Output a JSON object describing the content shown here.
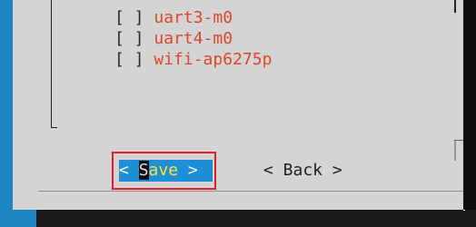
{
  "list": {
    "items": [
      {
        "checkbox": "[ ]",
        "name": "uart3-m0"
      },
      {
        "checkbox": "[ ]",
        "name": "uart4-m0"
      },
      {
        "checkbox": "[ ]",
        "name": "wifi-ap6275p"
      }
    ]
  },
  "buttons": {
    "save": {
      "left": "<",
      "hotkey": "S",
      "rest": "ave",
      "right": ">"
    },
    "back": {
      "label": "< Back >"
    }
  },
  "colors": {
    "terminal_blue": "#1f86c4",
    "dialog_bg": "#d4d4d4",
    "item_text": "#d9482c",
    "selected_button_bg": "#1e8fd6",
    "highlight_outline": "#e11e28"
  }
}
